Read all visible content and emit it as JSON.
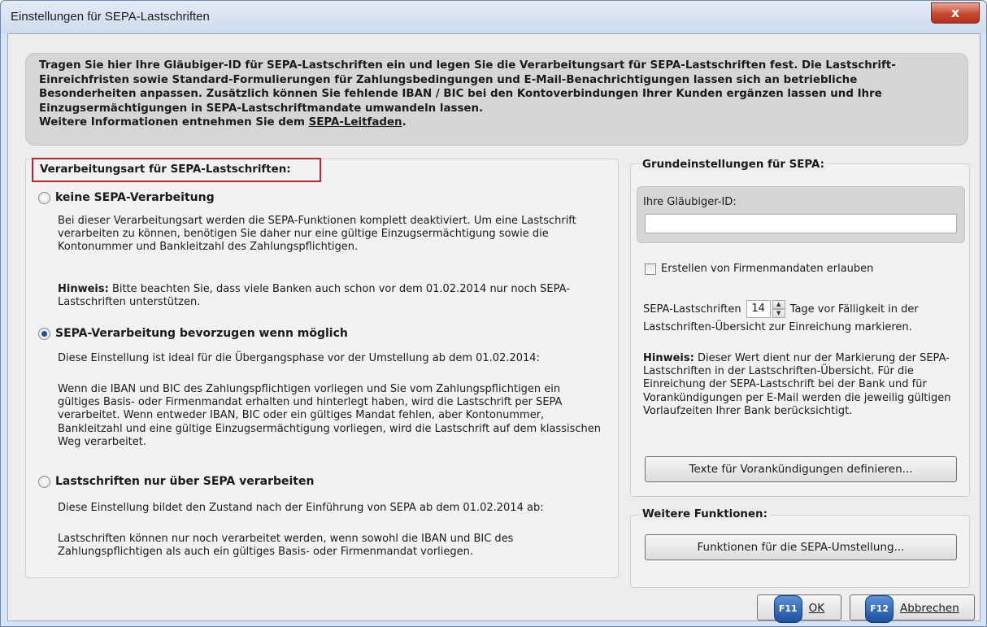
{
  "window": {
    "title": "Einstellungen für SEPA-Lastschriften",
    "close_label": "x"
  },
  "info": {
    "text": "Tragen Sie hier Ihre Gläubiger-ID für SEPA-Lastschriften ein und legen Sie die Verarbeitungsart für SEPA-Lastschriften fest. Die Lastschrift-Einreichfristen sowie Standard-Formulierungen für Zahlungsbedingungen und E-Mail-Benachrichtigungen lassen sich an betriebliche Besonderheiten anpassen. Zusätzlich können Sie fehlende IBAN / BIC bei den Kontoverbindungen Ihrer Kunden ergänzen lassen und Ihre Einzugsermächtigungen in SEPA-Lastschriftmandate umwandeln lassen.",
    "more_prefix": "Weitere Informationen entnehmen Sie dem ",
    "link": "SEPA-Leitfaden",
    "more_suffix": "."
  },
  "processing": {
    "title": "Verarbeitungsart für SEPA-Lastschriften:",
    "options": [
      {
        "label": "keine SEPA-Verarbeitung",
        "checked": false,
        "text": "Bei dieser Verarbeitungsart werden die SEPA-Funktionen komplett deaktiviert. Um eine Lastschrift verarbeiten zu können, benötigen Sie daher nur eine gültige Einzugsermächtigung sowie die Kontonummer und Bankleitzahl des Zahlungspflichtigen.",
        "hint_label": "Hinweis:",
        "hint_text": " Bitte beachten Sie, dass viele Banken auch schon vor dem 01.02.2014 nur noch SEPA-Lastschriften unterstützen."
      },
      {
        "label": "SEPA-Verarbeitung bevorzugen wenn möglich",
        "checked": true,
        "text": "Diese Einstellung ist ideal für die Übergangsphase vor der Umstellung ab dem 01.02.2014:",
        "text2": "Wenn die IBAN und BIC des Zahlungspflichtigen vorliegen und Sie vom Zahlungspflichtigen ein gültiges Basis- oder Firmenmandat erhalten und hinterlegt haben, wird die Lastschrift per SEPA verarbeitet. Wenn entweder IBAN, BIC oder ein gültiges Mandat fehlen, aber Kontonummer, Bankleitzahl und eine gültige Einzugsermächtigung vorliegen, wird die Lastschrift auf dem klassischen Weg verarbeitet."
      },
      {
        "label": "Lastschriften nur über SEPA verarbeiten",
        "checked": false,
        "text": "Diese Einstellung bildet den Zustand nach der Einführung von SEPA ab dem 01.02.2014 ab:",
        "text2": "Lastschriften können nur noch verarbeitet werden, wenn sowohl die IBAN und BIC des Zahlungspflichtigen als auch ein gültiges Basis- oder Firmenmandat vorliegen."
      }
    ]
  },
  "basic": {
    "title": "Grundeinstellungen für SEPA:",
    "creditor_id_label": "Ihre Gläubiger-ID:",
    "creditor_id_value": "",
    "firm_mandate_label": "Erstellen von Firmenmandaten erlauben",
    "firm_mandate_checked": false,
    "days_prefix": "SEPA-Lastschriften",
    "days_value": "14",
    "days_suffix": "Tage vor Fälligkeit in der",
    "days_line2": "Lastschriften-Übersicht zur Einreichung markieren.",
    "hint_label": "Hinweis:",
    "hint_text": " Dieser Wert dient nur der Markierung der SEPA-Lastschriften in der Lastschriften-Übersicht. Für die Einreichung der SEPA-Lastschrift bei der Bank und für Vorankündigungen per E-Mail werden die jeweilig gültigen Vorlaufzeiten Ihrer Bank berücksichtigt.",
    "texts_button": "Texte für Vorankündigungen definieren..."
  },
  "more": {
    "title": "Weitere Funktionen:",
    "functions_button": "Funktionen für die SEPA-Umstellung..."
  },
  "footer": {
    "ok_key": "F11",
    "ok_label": "OK",
    "cancel_key": "F12",
    "cancel_label": "Abbrechen"
  }
}
